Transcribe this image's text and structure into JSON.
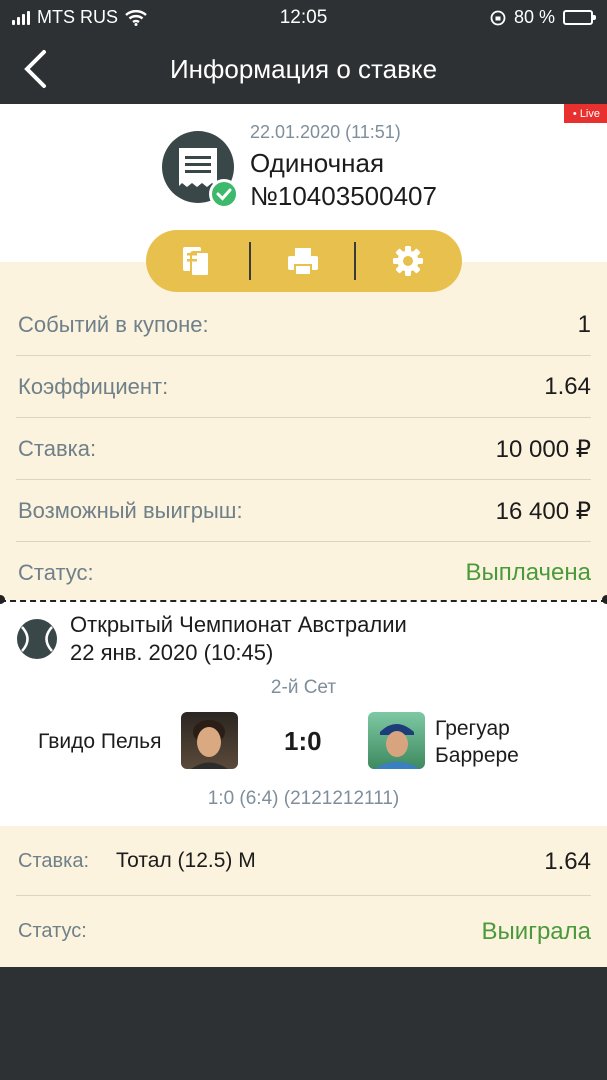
{
  "status_bar": {
    "carrier": "MTS RUS",
    "time": "12:05",
    "battery": "80 %",
    "battery_level": 0.8
  },
  "navbar": {
    "title": "Информация о ставке"
  },
  "header": {
    "live_badge": "• Live",
    "date": "22.01.2020 (11:51)",
    "type": "Одиночная",
    "number": "№10403500407"
  },
  "details": {
    "rows": [
      {
        "label": "Событий в купоне:",
        "value": "1"
      },
      {
        "label": "Коэффициент:",
        "value": "1.64"
      },
      {
        "label": "Ставка:",
        "value": "10 000 ₽"
      },
      {
        "label": "Возможный выигрыш:",
        "value": "16 400 ₽"
      },
      {
        "label": "Статус:",
        "value": "Выплачена"
      }
    ]
  },
  "event": {
    "tournament": "Открытый Чемпионат Австралии",
    "date": "22 янв. 2020 (10:45)",
    "set": "2-й Сет",
    "player1": "Гвидо Пелья",
    "score": "1:0",
    "player2_line1": "Грегуар",
    "player2_line2": "Баррере",
    "detail": "1:0 (6:4) (2121212111)"
  },
  "bet": {
    "label": "Ставка:",
    "name": "Тотал (12.5) М",
    "odds": "1.64",
    "status_label": "Статус:",
    "status_value": "Выиграла"
  },
  "colors": {
    "accent": "#e8c04d",
    "panel": "#fcf3df",
    "dark": "#2d3133",
    "green": "#4a9a3c",
    "live": "#e8312f"
  }
}
